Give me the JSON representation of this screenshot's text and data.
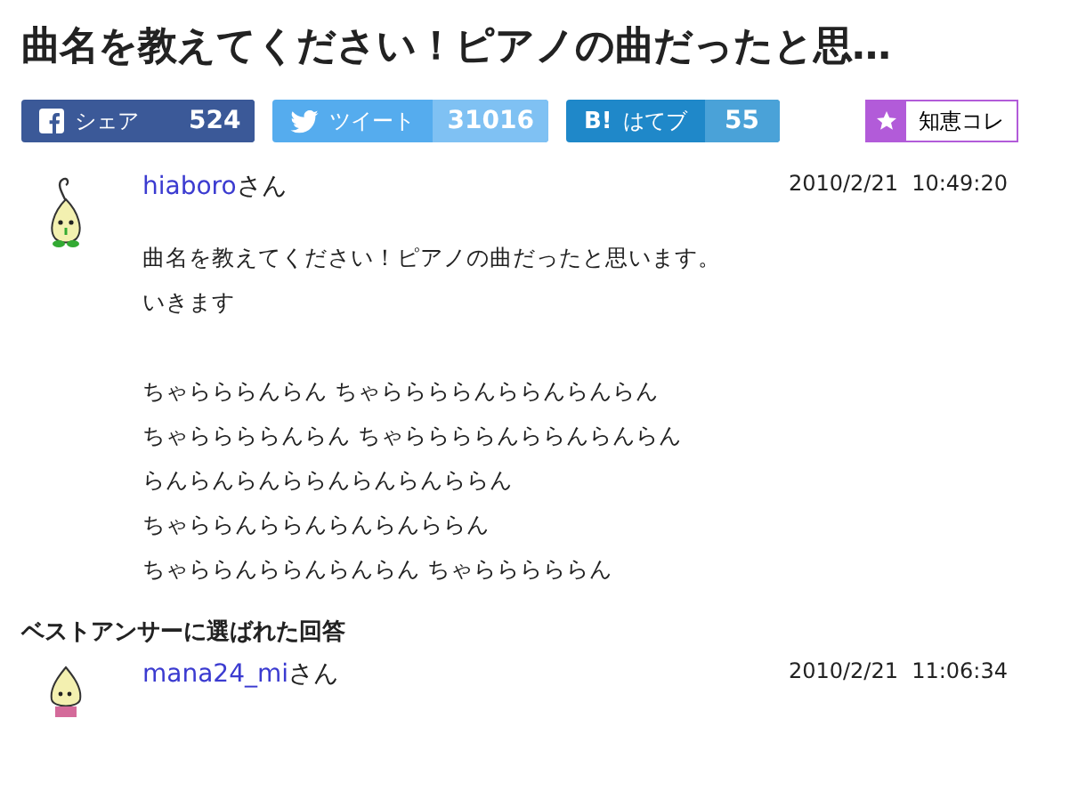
{
  "title": "曲名を教えてください！ピアノの曲だったと思…",
  "share_buttons": [
    {
      "kind": "facebook",
      "label": "シェア",
      "count": "524"
    },
    {
      "kind": "twitter",
      "label": "ツイート",
      "count": "31016"
    },
    {
      "kind": "hatena",
      "icon_text": "B!",
      "label": "はてブ",
      "count": "55"
    }
  ],
  "chiebukuro_button": {
    "label": "知恵コレ"
  },
  "question": {
    "user": "hiaboro",
    "suffix": "さん",
    "date": "2010/2/21  10:49:20",
    "paragraphs": [
      [
        "曲名を教えてください！ピアノの曲だったと思います。",
        "いきます"
      ],
      [
        "ちゃらららんらん ちゃららららんららんらんらん",
        "ちゃららららんらん ちゃららららんららんらんらん",
        "らんらんらんららんらんらんららん",
        "ちゃららんららんらんらんららん",
        "ちゃららんららんらんらん ちゃらららららん"
      ]
    ]
  },
  "best_answer": {
    "heading": "ベストアンサーに選ばれた回答",
    "user": "mana24_mi",
    "suffix": "さん",
    "date": "2010/2/21  11:06:34"
  }
}
